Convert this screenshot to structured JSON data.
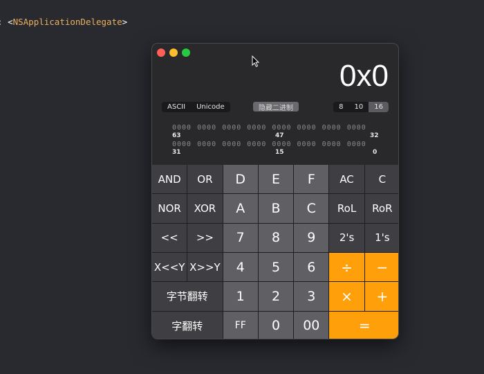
{
  "editor": {
    "prefix": ":",
    "open": "<",
    "class_name": "NSApplicationDelegate",
    "close": ">"
  },
  "window": {
    "traffic_lights": [
      "#ff5f57",
      "#febc2e",
      "#28c840"
    ]
  },
  "display": {
    "value": "0x0"
  },
  "encoding_toggle": {
    "options": [
      "ASCII",
      "Unicode"
    ]
  },
  "hide_binary_label": "隐藏二进制",
  "base_toggle": {
    "options": [
      "8",
      "10",
      "16"
    ],
    "selected": "16"
  },
  "binary": {
    "row1": "0000 0000 0000 0000 0000 0000 0000 0000",
    "row1_labels": [
      "63",
      "47",
      "32"
    ],
    "row2": "0000 0000 0000 0000 0000 0000 0000 0000",
    "row2_labels": [
      "31",
      "15",
      "0"
    ]
  },
  "keys": [
    {
      "label": "AND",
      "kind": "d"
    },
    {
      "label": "OR",
      "kind": "d"
    },
    {
      "label": "D",
      "kind": "l"
    },
    {
      "label": "E",
      "kind": "l"
    },
    {
      "label": "F",
      "kind": "l"
    },
    {
      "label": "AC",
      "kind": "d"
    },
    {
      "label": "C",
      "kind": "d"
    },
    {
      "label": "NOR",
      "kind": "d"
    },
    {
      "label": "XOR",
      "kind": "d"
    },
    {
      "label": "A",
      "kind": "l"
    },
    {
      "label": "B",
      "kind": "l"
    },
    {
      "label": "C",
      "kind": "l"
    },
    {
      "label": "RoL",
      "kind": "d"
    },
    {
      "label": "RoR",
      "kind": "d"
    },
    {
      "label": "<<",
      "kind": "d"
    },
    {
      "label": ">>",
      "kind": "d"
    },
    {
      "label": "7",
      "kind": "l"
    },
    {
      "label": "8",
      "kind": "l"
    },
    {
      "label": "9",
      "kind": "l"
    },
    {
      "label": "2's",
      "kind": "d"
    },
    {
      "label": "1's",
      "kind": "d"
    },
    {
      "label": "X<<Y",
      "kind": "d"
    },
    {
      "label": "X>>Y",
      "kind": "d"
    },
    {
      "label": "4",
      "kind": "l"
    },
    {
      "label": "5",
      "kind": "l"
    },
    {
      "label": "6",
      "kind": "l"
    },
    {
      "label": "÷",
      "kind": "o"
    },
    {
      "label": "−",
      "kind": "o"
    },
    {
      "label": "字节翻转",
      "kind": "d",
      "wide": true
    },
    {
      "label": "1",
      "kind": "l"
    },
    {
      "label": "2",
      "kind": "l"
    },
    {
      "label": "3",
      "kind": "l"
    },
    {
      "label": "×",
      "kind": "o"
    },
    {
      "label": "+",
      "kind": "o"
    },
    {
      "label": "字翻转",
      "kind": "d",
      "wide": true
    },
    {
      "label": "FF",
      "kind": "l"
    },
    {
      "label": "0",
      "kind": "l"
    },
    {
      "label": "00",
      "kind": "l"
    },
    {
      "label": "=",
      "kind": "o",
      "wide": true
    }
  ]
}
